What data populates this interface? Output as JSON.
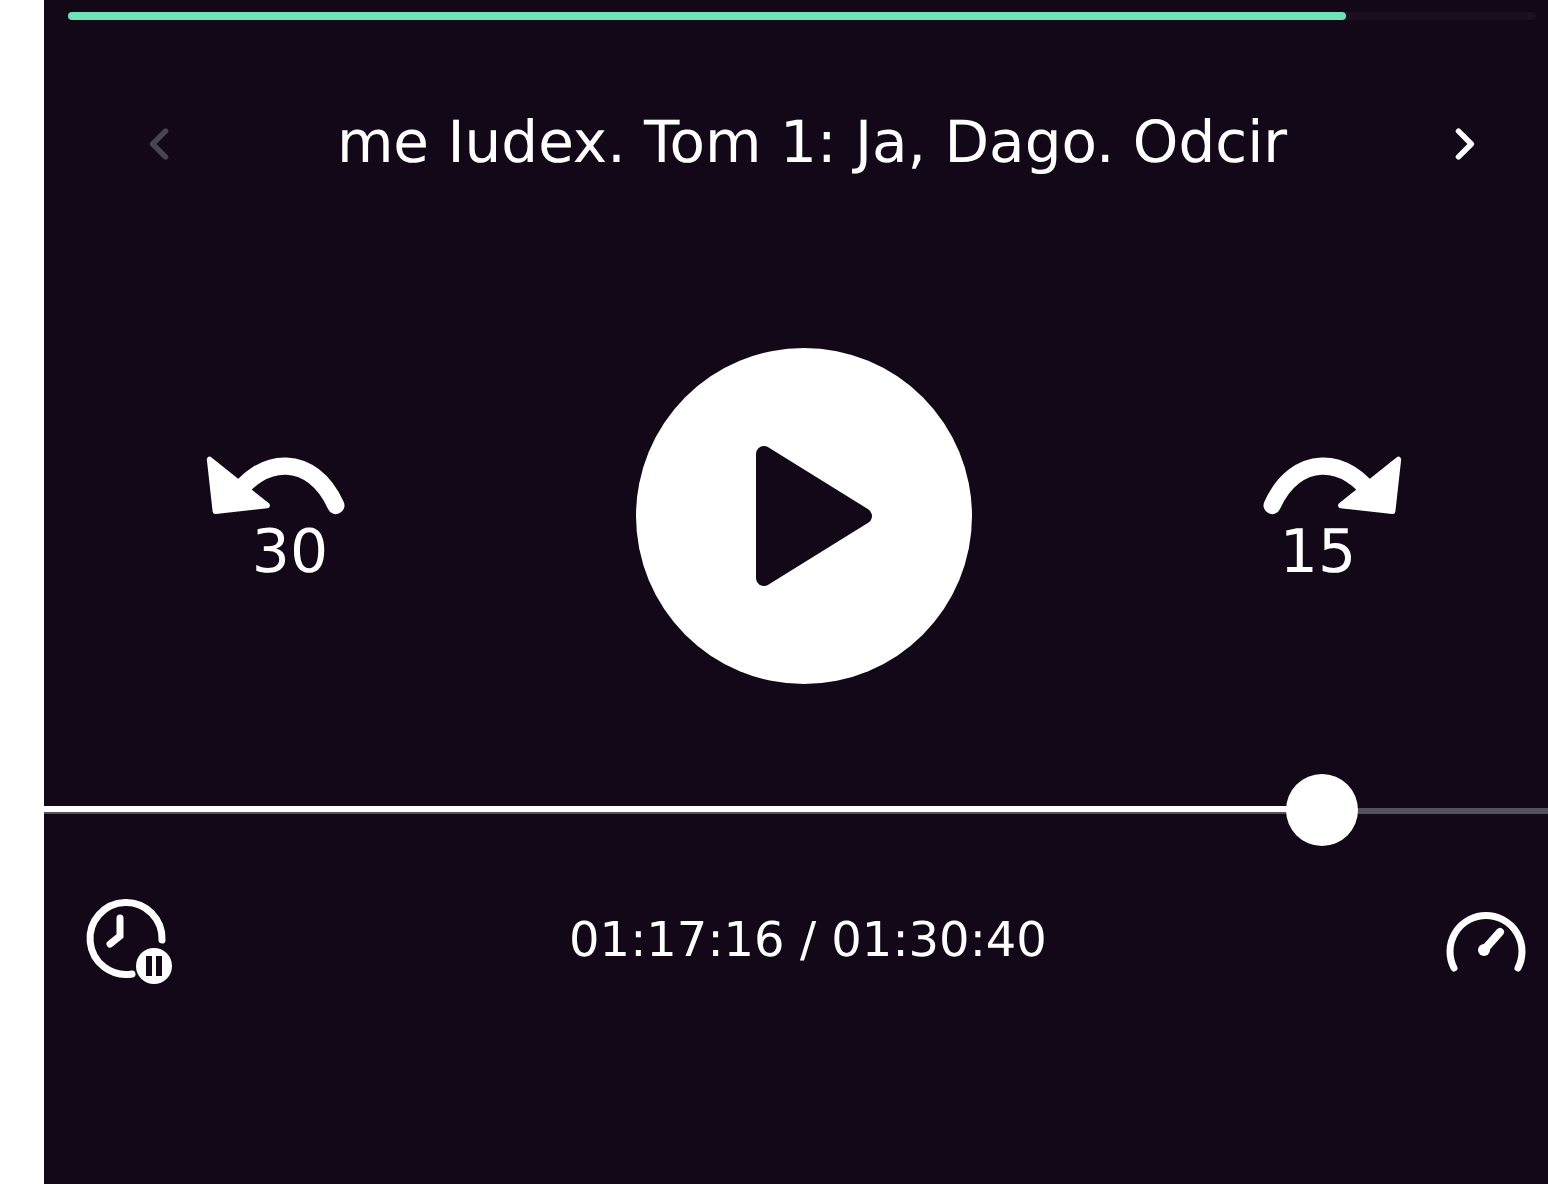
{
  "loading_bar": {
    "level": 0.87
  },
  "title_bar": {
    "title": "me Iudex. Tom 1: Ja, Dago. Odcir",
    "prev_disabled": true,
    "next_disabled": false
  },
  "controls": {
    "rewind_label": "30",
    "forward_label": "15",
    "playing": false
  },
  "seek": {
    "level": 0.85
  },
  "time": "01:17:16 / 01:30:40"
}
